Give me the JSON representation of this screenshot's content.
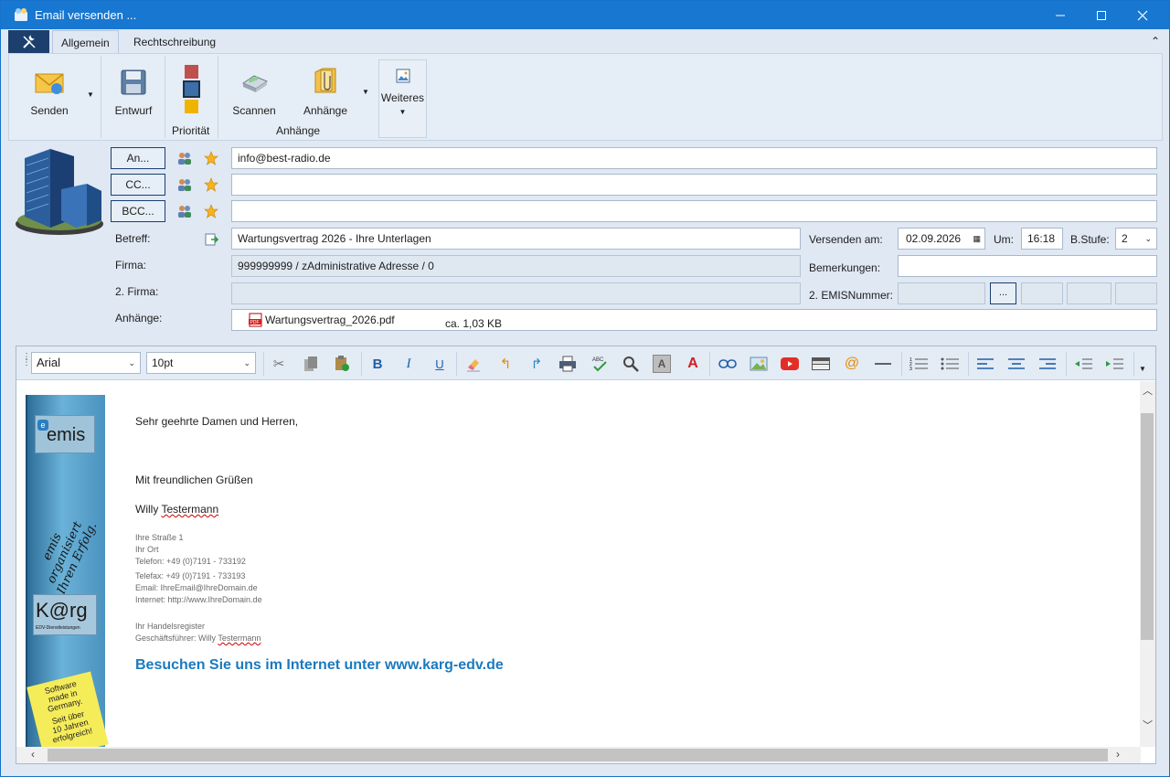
{
  "window": {
    "title": "Email versenden ...",
    "controls": {
      "minimize": "—",
      "maximize": "☐",
      "close": "✕"
    }
  },
  "ribbon": {
    "tabs": [
      {
        "label": "Allgemein",
        "active": true
      },
      {
        "label": "Rechtschreibung",
        "active": false
      }
    ],
    "collapse_glyph": "⌃",
    "buttons": {
      "send": "Senden",
      "draft": "Entwurf",
      "scan": "Scannen",
      "attachments": "Anhänge",
      "more": "Weiteres"
    },
    "groups": {
      "priority": "Priorität",
      "attachments": "Anhänge"
    },
    "priority_colors": [
      "#c0504d",
      "#3a6fa8",
      "#f0b400"
    ]
  },
  "header": {
    "to_button": "An...",
    "cc_button": "CC...",
    "bcc_button": "BCC...",
    "to_value": "info@best-radio.de",
    "cc_value": "",
    "bcc_value": "",
    "subject_label": "Betreff:",
    "subject_value": "Wartungsvertrag 2026 - Ihre Unterlagen",
    "company_label": "Firma:",
    "company_value": "999999999 / zAdministrative Adresse / 0",
    "company2_label": "2. Firma:",
    "company2_value": "",
    "attachments_label": "Anhänge:",
    "attachment_file": "Wartungsvertrag_2026.pdf",
    "attachment_size": "ca. 1,03 KB",
    "send_on_label": "Versenden am:",
    "send_on_value": "02.09.2026",
    "time_label": "Um:",
    "time_value": "16:18",
    "level_label": "B.Stufe:",
    "level_value": "2",
    "remarks_label": "Bemerkungen:",
    "remarks_value": "",
    "emis2_label": "2. EMISNummer:",
    "emis2_button": "..."
  },
  "editor": {
    "font_family": "Arial",
    "font_size": "10pt",
    "toolbar_icons": [
      "cut-icon",
      "copy-icon",
      "paste-icon",
      "bold-icon",
      "italic-icon",
      "underline-icon",
      "eraser-icon",
      "undo-icon",
      "redo-icon",
      "print-icon",
      "spellcheck-icon",
      "find-icon",
      "highlight-icon",
      "font-color-icon",
      "link-icon",
      "image-icon",
      "youtube-icon",
      "table-icon",
      "email-at-icon",
      "horizontal-line-icon",
      "numbered-list-icon",
      "bullet-list-icon",
      "align-left-icon",
      "align-center-icon",
      "align-right-icon",
      "outdent-icon",
      "indent-icon"
    ],
    "body": {
      "greeting": "Sehr geehrte Damen und Herren,",
      "closing": "Mit freundlichen Grüßen",
      "name_first": "Willy ",
      "name_last": "Testermann",
      "sig_lines": [
        "Ihre Straße 1",
        "Ihr Ort",
        "Telefon: +49 (0)7191 - 733192",
        "Telefax: +49 (0)7191 - 733193",
        "Email:  IhreEmail@IhreDomain.de",
        "Internet: http://www.IhreDomain.de"
      ],
      "register": "Ihr Handelsregister",
      "ceo_prefix": "Geschäftsführer: Willy ",
      "ceo_last": "Testermann",
      "link_line": "Besuchen Sie uns im Internet unter www.karg-edv.de",
      "link_color": "#1a7abf"
    },
    "banner": {
      "logo_top": "emis",
      "slogan": "emis organisiert Ihren Erfolg.",
      "logo_bottom": "K@rg",
      "logo_sub": "EDV-Dienstleistungen",
      "sticker_lines": [
        "Software",
        "made in",
        "Germany.",
        "Seit über",
        "10 Jahren",
        "erfolgreich!"
      ]
    }
  }
}
